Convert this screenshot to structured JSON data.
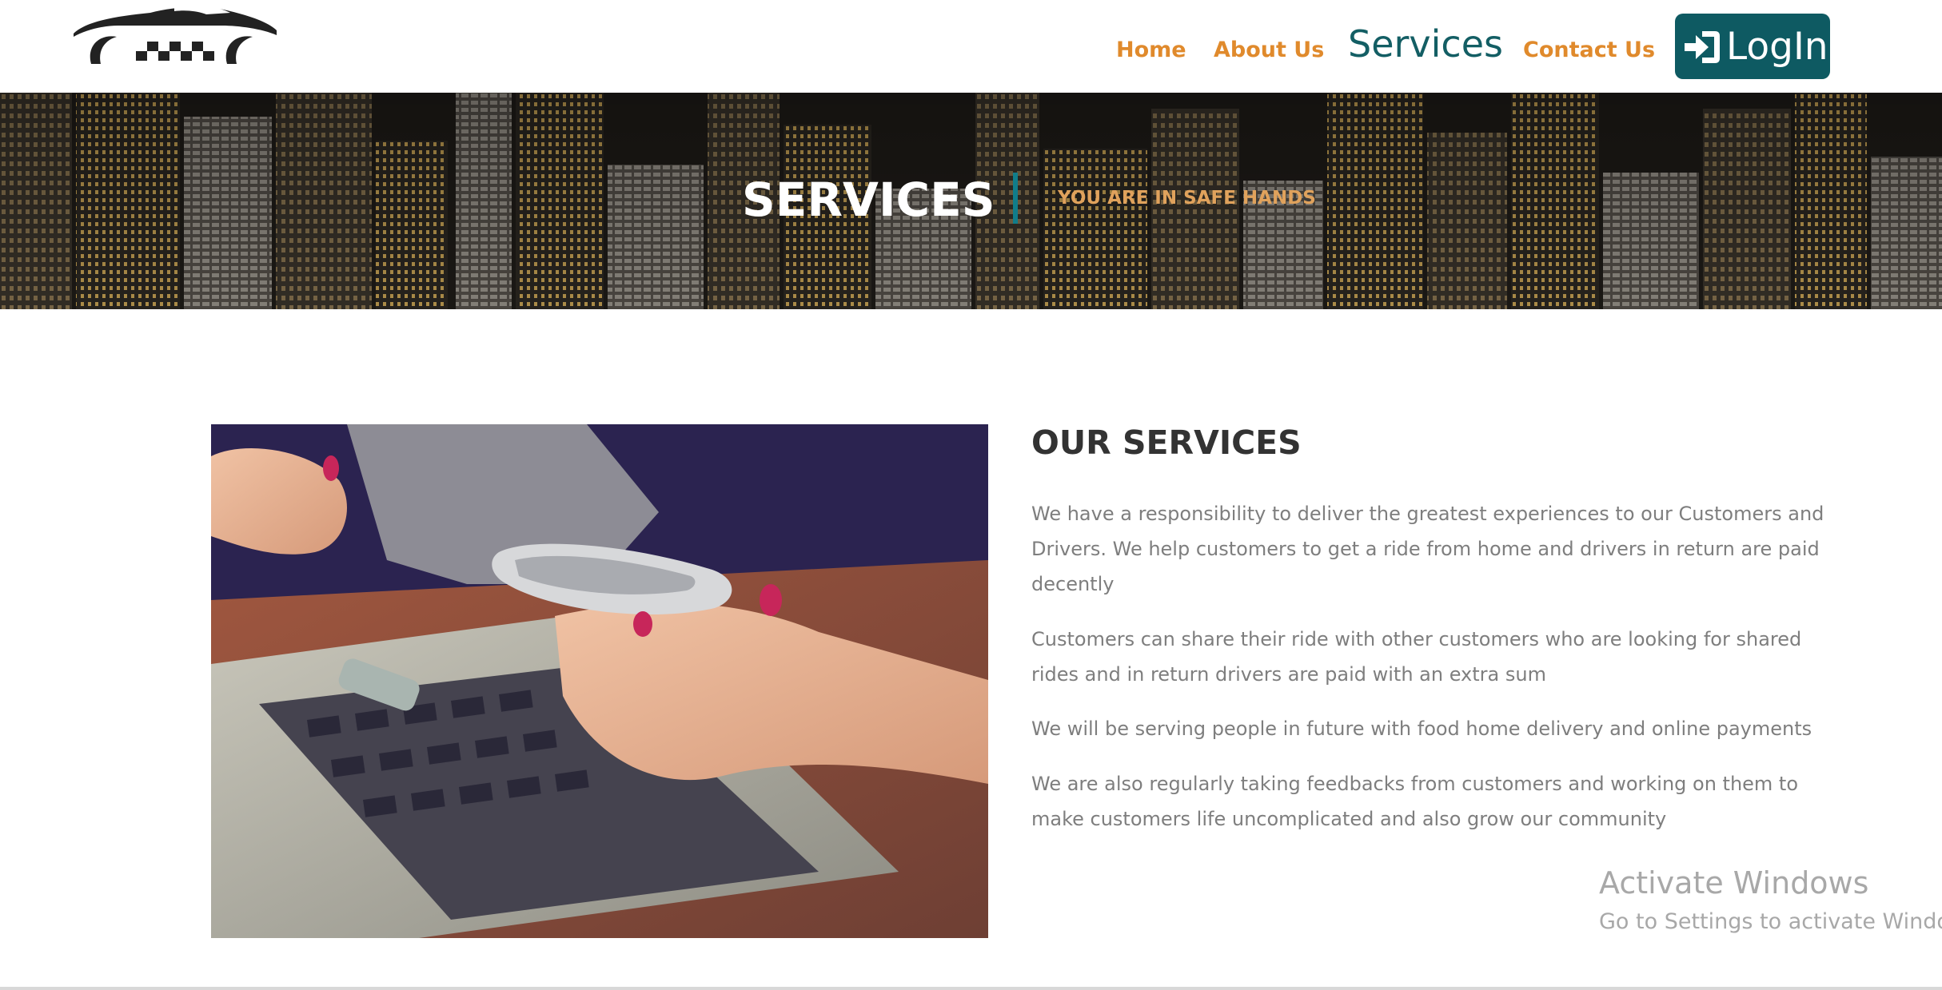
{
  "nav": {
    "items": [
      {
        "label": "Home"
      },
      {
        "label": "About Us"
      },
      {
        "label": "Services"
      },
      {
        "label": "Contact Us"
      }
    ],
    "login_label": "LogIn"
  },
  "banner": {
    "title": "SERVICES",
    "tagline": "YOU ARE IN SAFE HANDS"
  },
  "services": {
    "heading": "OUR SERVICES",
    "paragraphs": [
      "We have a responsibility to deliver the greatest experiences to our Customers and Drivers. We help customers to get a ride from home and drivers in return are paid decently",
      "Customers can share their ride with other customers who are looking for shared rides and in return drivers are paid with an extra sum",
      "We will be serving people in future with food home delivery and online payments",
      "We are also regularly taking feedbacks from customers and working on them to make customers life uncomplicated and also grow our community"
    ]
  },
  "watermark": {
    "title": "Activate Windows",
    "subtitle": "Go to Settings to activate Windows."
  },
  "colors": {
    "nav_accent": "#e08a2c",
    "nav_active": "#135e64",
    "login_bg": "#0e5a62",
    "divider": "#117d8a",
    "tagline": "#e0a25c"
  },
  "icons": {
    "logo": "taxi-car-logo",
    "login": "login-arrow-icon"
  }
}
